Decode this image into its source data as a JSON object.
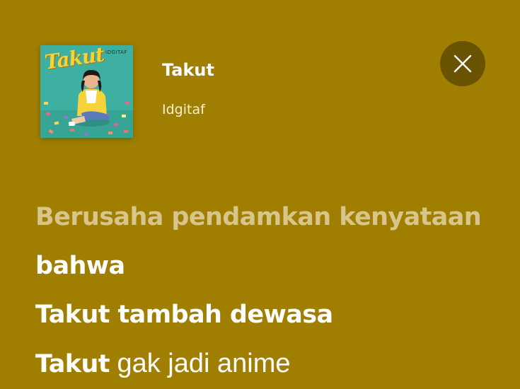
{
  "header": {
    "album_art_text": "Takut",
    "album_art_artist": "IDGITAF",
    "track_title": "Takut",
    "artist": "Idgitaf",
    "close_icon": "close-icon"
  },
  "colors": {
    "background": "#9f7e00",
    "past_lyric": "#d8c58a",
    "current_lyric": "#ffffff",
    "close_button_bg": "#5a4500"
  },
  "lyrics": [
    {
      "text": "Berusaha pendamkan kenyataan",
      "state": "past"
    },
    {
      "text": "bahwa",
      "state": "current"
    },
    {
      "text": "Takut tambah dewasa",
      "state": "upcoming"
    },
    {
      "prefix": "Takut",
      "rest": " gak jadi anime",
      "state": "upcoming"
    }
  ]
}
